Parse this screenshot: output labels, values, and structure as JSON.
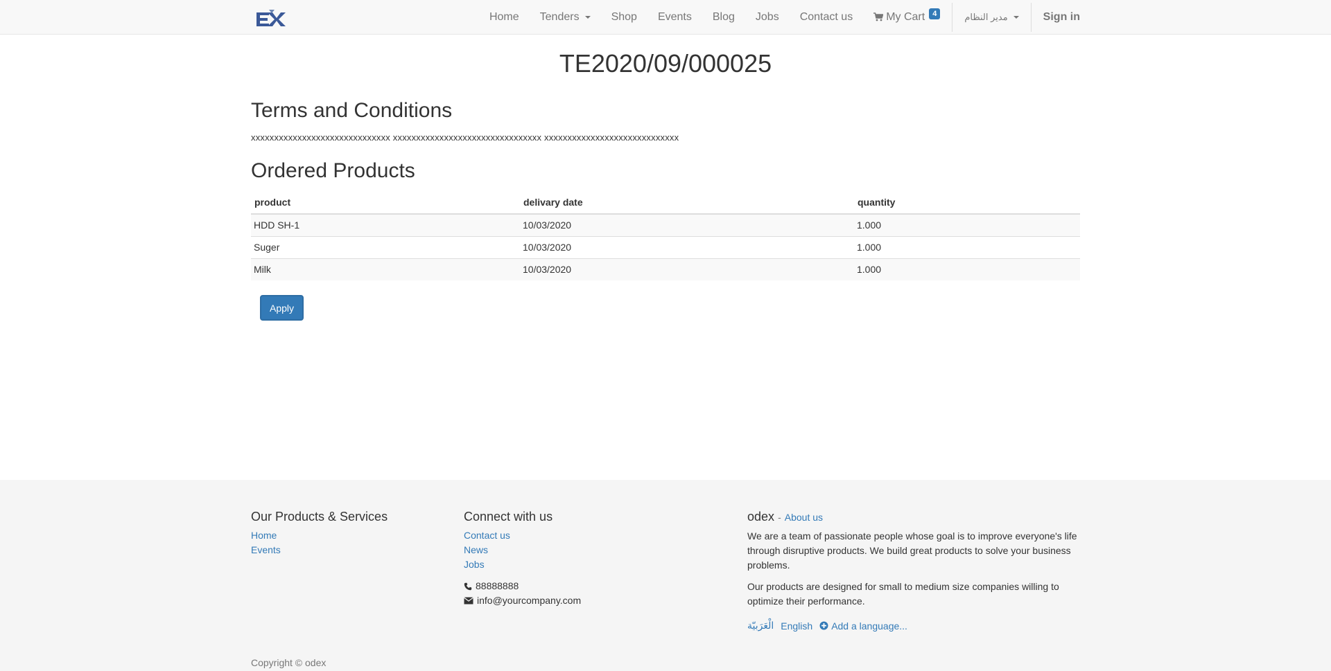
{
  "navbar": {
    "brand": "EX",
    "items": {
      "home": "Home",
      "tenders": "Tenders",
      "shop": "Shop",
      "events": "Events",
      "blog": "Blog",
      "jobs": "Jobs",
      "contact": "Contact us",
      "cart": "My Cart",
      "cart_count": "4",
      "user": "مدير النظام",
      "signin": "Sign in"
    },
    "icons": {
      "cart": "cart-icon",
      "user_dropdown": "chevron-down-icon"
    }
  },
  "main": {
    "title": "TE2020/09/000025",
    "terms_heading": "Terms and Conditions",
    "terms_text": "xxxxxxxxxxxxxxxxxxxxxxxxxxxxxx xxxxxxxxxxxxxxxxxxxxxxxxxxxxxxxx xxxxxxxxxxxxxxxxxxxxxxxxxxxxx",
    "ordered_heading": "Ordered Products",
    "table": {
      "headers": [
        "product",
        "delivary date",
        "quantity"
      ],
      "rows": [
        [
          "HDD SH-1",
          "10/03/2020",
          "1.000"
        ],
        [
          "Suger",
          "10/03/2020",
          "1.000"
        ],
        [
          "Milk",
          "10/03/2020",
          "1.000"
        ]
      ]
    },
    "apply_label": "Apply"
  },
  "footer": {
    "col1_title": "Our Products & Services",
    "col1_links": [
      "Home",
      "Events"
    ],
    "col2_title": "Connect with us",
    "col2_links": [
      "Contact us",
      "News",
      "Jobs"
    ],
    "phone": "88888888",
    "email": "info@yourcompany.com",
    "about_company": "odex",
    "about_dash": "-",
    "about_link": "About us",
    "about_p1": "We are a team of passionate people whose goal is to improve everyone's life through disruptive products. We build great products to solve your business problems.",
    "about_p2": "Our products are designed for small to medium size companies willing to optimize their performance.",
    "lang_ar": "الْعَرَبيّة",
    "lang_en": "English",
    "add_language": "Add a language...",
    "copyright": "Copyright © odex"
  },
  "colors": {
    "primary": "#337ab7",
    "navbar_bg": "#f8f8f8",
    "footer_bg": "#f5f5f5"
  }
}
